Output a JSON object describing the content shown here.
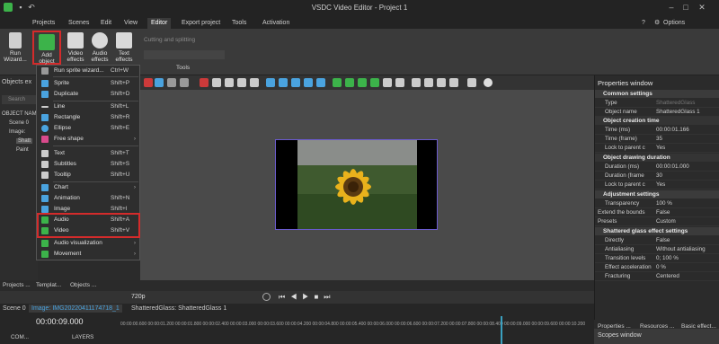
{
  "window": {
    "title": "VSDC Video Editor - Project 1",
    "options_label": "Options"
  },
  "menu": {
    "tabs": [
      "Projects",
      "Scenes",
      "Edit",
      "View",
      "Editor",
      "Export project",
      "Tools",
      "Activation"
    ],
    "active": "Editor"
  },
  "ribbon": {
    "buttons": [
      {
        "label": "Run Wizard...",
        "color": "#d9d9d9"
      },
      {
        "label": "Add object",
        "color": "#3cb34a"
      },
      {
        "label": "Video effects",
        "color": "#d9d9d9"
      },
      {
        "label": "Audio effects",
        "color": "#d9d9d9"
      },
      {
        "label": "Text effects",
        "color": "#d9d9d9"
      }
    ],
    "cutting_label": "Cutting and splitting",
    "tools_label": "Tools"
  },
  "left_panel": {
    "title": "Objects ex",
    "search_placeholder": "Search",
    "column": "OBJECT NAM",
    "rows": [
      "Scene 0",
      "Image:",
      "Shatt",
      "Paint"
    ],
    "bottom_tabs": [
      "Projects ...",
      "Templat...",
      "Objects ..."
    ]
  },
  "dropdown": {
    "items": [
      {
        "label": "Run sprite wizard...",
        "shortcut": "Ctrl+W",
        "color": "#9aa"
      },
      {
        "label": "Sprite",
        "shortcut": "Shift+P",
        "color": "#4aa3df"
      },
      {
        "label": "Duplicate",
        "shortcut": "Shift+D",
        "color": "#4aa3df"
      },
      {
        "label": "Line",
        "shortcut": "Shift+L",
        "color": "#cccccc"
      },
      {
        "label": "Rectangle",
        "shortcut": "Shift+R",
        "color": "#4aa3df"
      },
      {
        "label": "Ellipse",
        "shortcut": "Shift+E",
        "color": "#4aa3df"
      },
      {
        "label": "Free shape",
        "shortcut": "",
        "color": "#d94a8c"
      },
      {
        "label": "Text",
        "shortcut": "Shift+T",
        "color": "#cccccc"
      },
      {
        "label": "Subtitles",
        "shortcut": "Shift+S",
        "color": "#cccccc"
      },
      {
        "label": "Tooltip",
        "shortcut": "Shift+U",
        "color": "#cccccc"
      },
      {
        "label": "Chart",
        "shortcut": "",
        "color": "#4aa3df"
      },
      {
        "label": "Animation",
        "shortcut": "Shift+N",
        "color": "#4aa3df"
      },
      {
        "label": "Image",
        "shortcut": "Shift+I",
        "color": "#4aa3df"
      },
      {
        "label": "Audio",
        "shortcut": "Shift+A",
        "color": "#3cb34a"
      },
      {
        "label": "Video",
        "shortcut": "Shift+V",
        "color": "#3cb34a"
      },
      {
        "label": "Audio visualization",
        "shortcut": "",
        "color": "#3cb34a"
      },
      {
        "label": "Movement",
        "shortcut": "",
        "color": "#3cb34a"
      }
    ]
  },
  "properties": {
    "title": "Properties window",
    "sections": {
      "common": "Common settings",
      "creation": "Object creation time",
      "duration": "Object drawing duration",
      "adjust": "Adjustment settings",
      "effect": "Shattered glass effect settings"
    },
    "rows": [
      {
        "k": "Type",
        "v": "ShatteredGlass"
      },
      {
        "k": "Object name",
        "v": "ShatteredGlass 1"
      },
      {
        "k": "Time (ms)",
        "v": "00:00:01.166"
      },
      {
        "k": "Time (frame)",
        "v": "35"
      },
      {
        "k": "Lock to parent c",
        "v": "Yes"
      },
      {
        "k": "Duration (ms)",
        "v": "00:00:01.000"
      },
      {
        "k": "Duration (frame",
        "v": "30"
      },
      {
        "k": "Lock to parent c",
        "v": "Yes"
      },
      {
        "k": "Transparency",
        "v": "100 %"
      },
      {
        "k": "Extend the bounds",
        "v": "False"
      },
      {
        "k": "Presets",
        "v": "Custom"
      },
      {
        "k": "Directly",
        "v": "False"
      },
      {
        "k": "Antialiasing",
        "v": "Without antialiasing"
      },
      {
        "k": "Transition levels",
        "v": "0; 100 %"
      },
      {
        "k": "Effect acceleration",
        "v": "0 %"
      },
      {
        "k": "Fracturing",
        "v": "Centered"
      }
    ],
    "bottom_tabs": [
      "Properties ...",
      "Resources ...",
      "Basic effect..."
    ],
    "scopes": "Scopes window"
  },
  "timeline": {
    "zoom": "720p",
    "scene_tab": "Scene 0",
    "image_tab": "Image: IMG20220411174718_1",
    "effect_tab": "ShatteredGlass: ShatteredGlass 1",
    "time": "00:00:09.000",
    "com_label": "COM...",
    "layers_label": "LAYERS",
    "ticks": [
      "00:00:00.600",
      "00:00:01.200",
      "00:00:01.800",
      "00:00:02.400",
      "00:00:03.000",
      "00:00:03.600",
      "00:00:04.200",
      "00:00:04.800",
      "00:00:05.400",
      "00:00:06.000",
      "00:00:06.600",
      "00:00:07.200",
      "00:00:07.800",
      "00:00:08.400",
      "00:00:09.000",
      "00:00:09.600",
      "00:00:10.200"
    ]
  }
}
